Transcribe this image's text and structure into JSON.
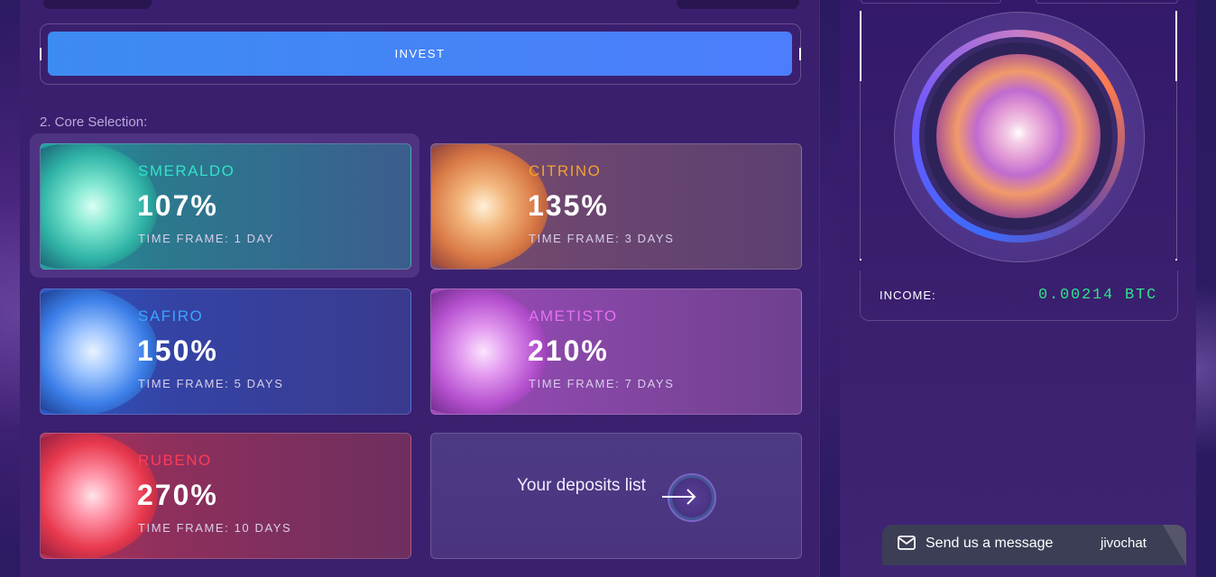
{
  "invest": {
    "button_label": "INVEST"
  },
  "section": {
    "core_selection_label": "2. Core Selection:"
  },
  "cores": [
    {
      "name": "SMERALDO",
      "percent": "107%",
      "time_frame": "TIME FRAME: 1 DAY",
      "selected": true,
      "accent": "#30e3c8"
    },
    {
      "name": "CITRINO",
      "percent": "135%",
      "time_frame": "TIME FRAME: 3 DAYS",
      "selected": false,
      "accent": "#f3a22e"
    },
    {
      "name": "SAFIRO",
      "percent": "150%",
      "time_frame": "TIME FRAME: 5 DAYS",
      "selected": false,
      "accent": "#3aa6ff"
    },
    {
      "name": "AMETISTO",
      "percent": "210%",
      "time_frame": "TIME FRAME: 7 DAYS",
      "selected": false,
      "accent": "#e571f2"
    },
    {
      "name": "RUBENO",
      "percent": "270%",
      "time_frame": "TIME FRAME: 10 DAYS",
      "selected": false,
      "accent": "#ff3b58"
    }
  ],
  "deposits": {
    "label": "Your deposits list",
    "icon": "arrow-right-icon"
  },
  "income": {
    "label": "INCOME:",
    "value": "0.00214",
    "currency": "BTC",
    "value_color": "#2ee28a"
  },
  "chat": {
    "label": "Send us a message",
    "brand": "jivochat",
    "icon": "mail-icon"
  },
  "colors": {
    "invest_button": "#4182f7",
    "background": "#3a1f6f"
  }
}
